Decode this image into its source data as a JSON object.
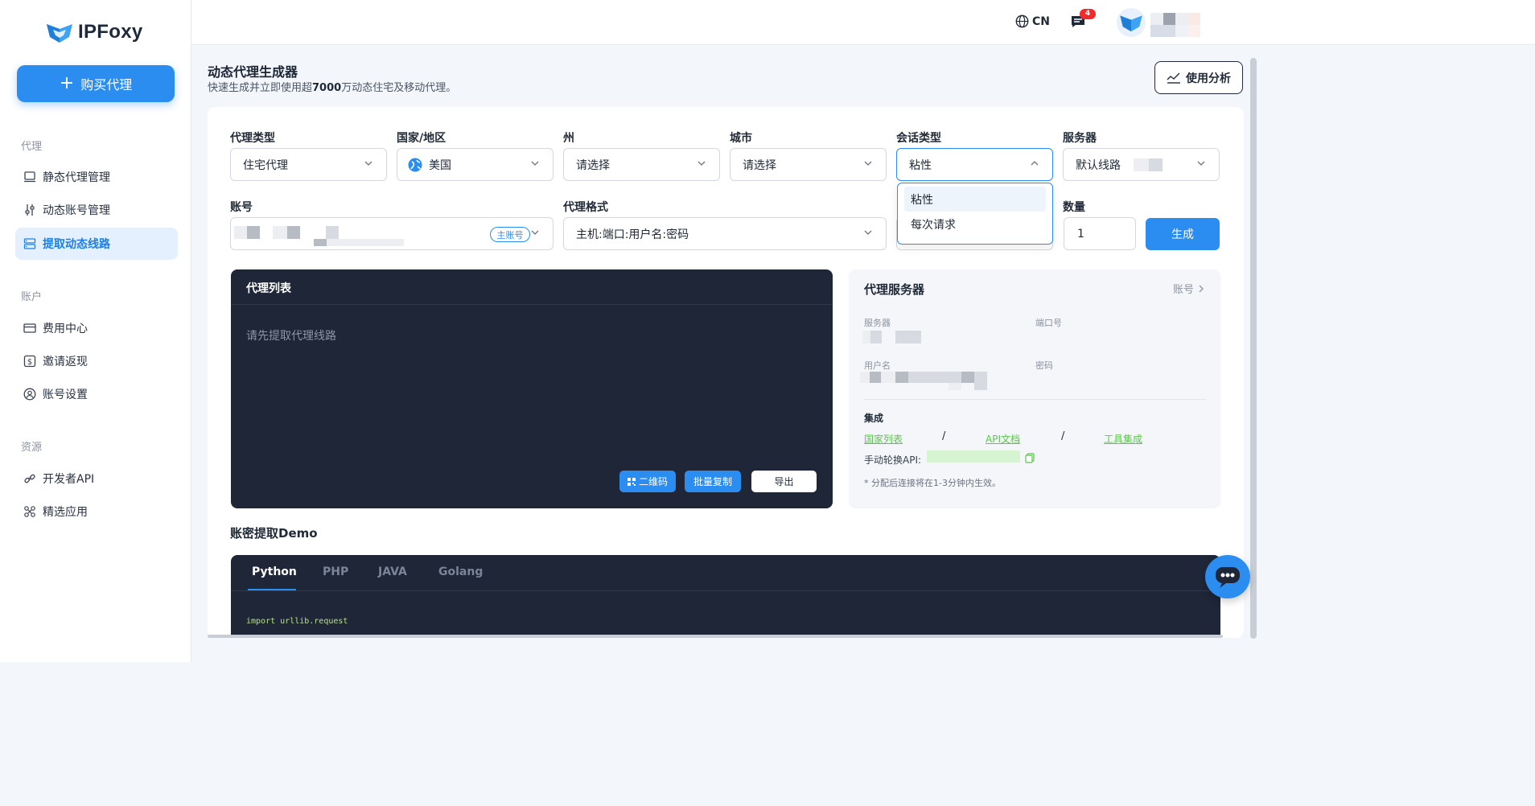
{
  "app": {
    "name": "IPFoxy"
  },
  "sidebar": {
    "buy_label": "购买代理",
    "sections": [
      {
        "title": "代理",
        "items": [
          {
            "label": "静态代理管理",
            "icon": "laptop-icon"
          },
          {
            "label": "动态账号管理",
            "icon": "sliders-icon"
          },
          {
            "label": "提取动态线路",
            "icon": "server-stack-icon",
            "active": true
          }
        ]
      },
      {
        "title": "账户",
        "items": [
          {
            "label": "费用中心",
            "icon": "credit-card-icon"
          },
          {
            "label": "邀请返现",
            "icon": "dollar-icon"
          },
          {
            "label": "账号设置",
            "icon": "user-circle-icon"
          }
        ]
      },
      {
        "title": "资源",
        "items": [
          {
            "label": "开发者API",
            "icon": "link-icon"
          },
          {
            "label": "精选应用",
            "icon": "apps-icon"
          }
        ]
      }
    ]
  },
  "topbar": {
    "lang": "CN",
    "message_count": "4"
  },
  "page": {
    "title": "动态代理生成器",
    "subtitle_pre": "快速生成并立即使用超",
    "subtitle_bold": "7000",
    "subtitle_post": "万动态住宅及移动代理。",
    "usage_button": "使用分析"
  },
  "form": {
    "proxy_type": {
      "label": "代理类型",
      "value": "住宅代理"
    },
    "country": {
      "label": "国家/地区",
      "value": "美国"
    },
    "state": {
      "label": "州",
      "value": "请选择"
    },
    "city": {
      "label": "城市",
      "value": "请选择"
    },
    "session": {
      "label": "会话类型",
      "value": "粘性",
      "options": [
        "粘性",
        "每次请求"
      ]
    },
    "server": {
      "label": "服务器",
      "value": "默认线路"
    },
    "account": {
      "label": "账号",
      "tag": "主账号"
    },
    "format": {
      "label": "代理格式",
      "value": "主机:端口:用户名:密码"
    },
    "quantity": {
      "label": "数量",
      "value": "1"
    },
    "generate_label": "生成"
  },
  "proxy_list": {
    "title": "代理列表",
    "empty_text": "请先提取代理线路",
    "qr_label": "二维码",
    "copy_label": "批量复制",
    "export_label": "导出"
  },
  "proxy_server": {
    "title": "代理服务器",
    "account_link": "账号",
    "server_label": "服务器",
    "port_label": "端口号",
    "username_label": "用户名",
    "password_label": "密码",
    "integration_title": "集成",
    "links": [
      "国家列表",
      "API文档",
      "工具集成"
    ],
    "slash": "/",
    "manual_api_label": "手动轮换API:",
    "note": "* 分配后连接将在1-3分钟内生效。"
  },
  "demo": {
    "title": "账密提取Demo",
    "tabs": [
      "Python",
      "PHP",
      "JAVA",
      "Golang"
    ],
    "code_line": "import urllib.request"
  },
  "colors": {
    "accent": "#2b8df0",
    "dark_panel": "#1e2638",
    "link_green": "#5ac74b",
    "badge_red": "#ef2b2b"
  }
}
